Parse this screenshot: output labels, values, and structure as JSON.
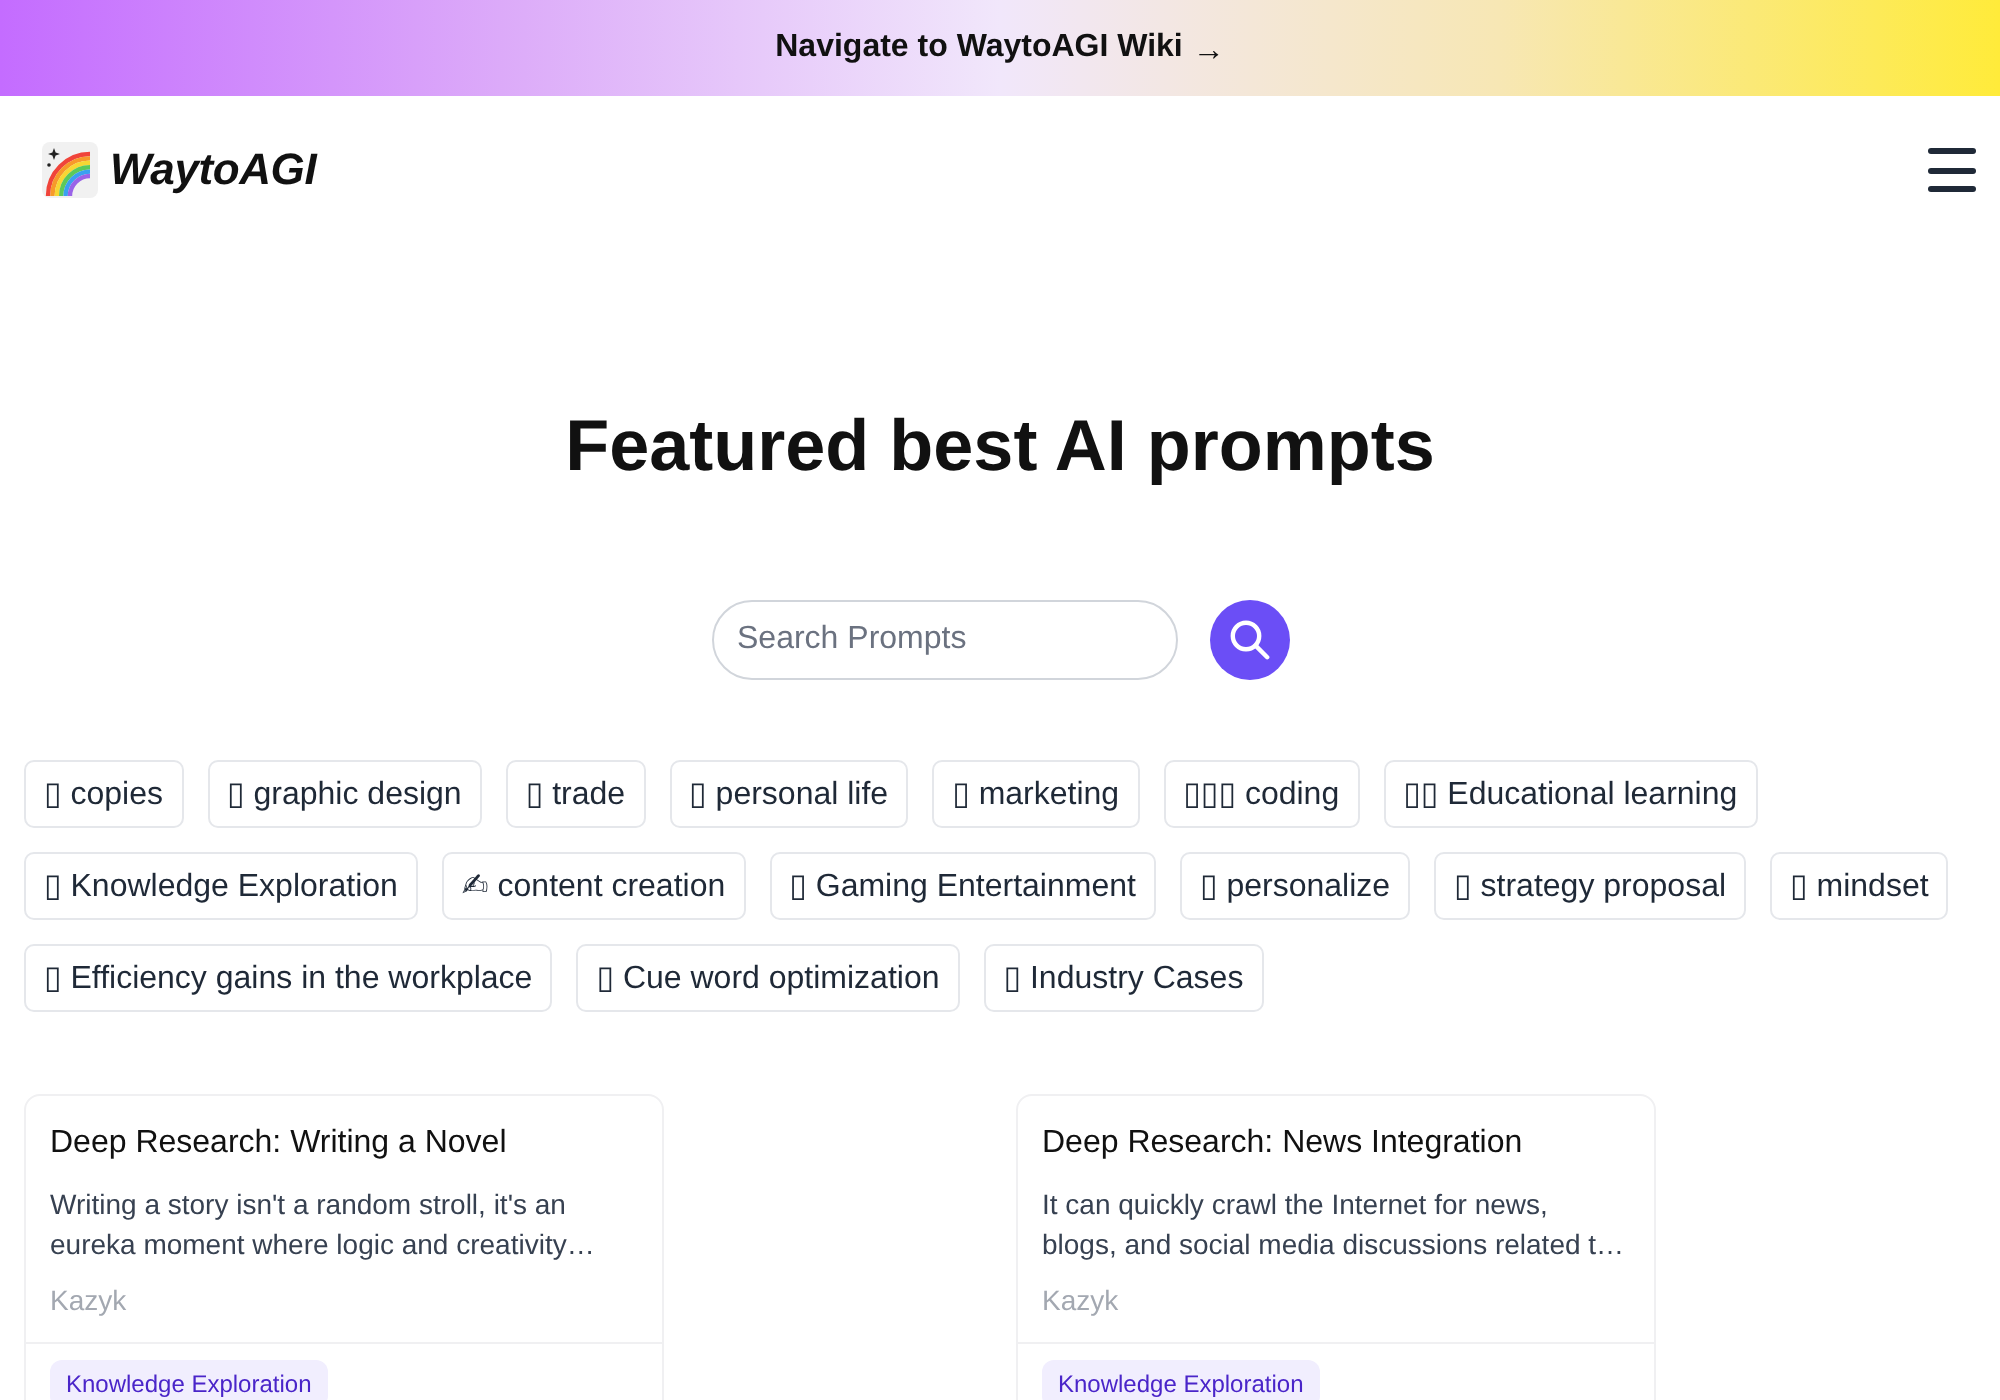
{
  "banner": {
    "link_text": "Navigate to WaytoAGI Wiki",
    "arrow": "→"
  },
  "header": {
    "logo_text": "WaytoAGI"
  },
  "hero": {
    "title": "Featured best AI prompts"
  },
  "search": {
    "placeholder": "Search Prompts"
  },
  "categories": [
    {
      "icon": "▯",
      "label": "copies"
    },
    {
      "icon": "▯",
      "label": "graphic design"
    },
    {
      "icon": "▯",
      "label": "trade"
    },
    {
      "icon": "▯",
      "label": "personal life"
    },
    {
      "icon": "▯",
      "label": "marketing"
    },
    {
      "icon": "▯▯▯",
      "label": "coding"
    },
    {
      "icon": "▯▯",
      "label": "Educational learning"
    },
    {
      "icon": "▯",
      "label": "Knowledge Exploration"
    },
    {
      "icon": "✍",
      "label": "content creation"
    },
    {
      "icon": "▯",
      "label": "Gaming Entertainment"
    },
    {
      "icon": "▯",
      "label": "personalize"
    },
    {
      "icon": "▯",
      "label": "strategy proposal"
    },
    {
      "icon": "▯",
      "label": "mindset"
    },
    {
      "icon": "▯",
      "label": "Efficiency gains in the workplace"
    },
    {
      "icon": "▯",
      "label": "Cue word optimization"
    },
    {
      "icon": "▯",
      "label": "Industry Cases"
    }
  ],
  "prompt_cards": [
    {
      "title": "Deep Research: Writing a Novel",
      "description": "Writing a story isn't a random stroll, it's an eureka moment where logic and creativity…",
      "author": "Kazyk",
      "tags": [
        "Knowledge Exploration"
      ]
    },
    {
      "title": "Deep Research: News Integration",
      "description": "It can quickly crawl the Internet for news, blogs, and social media discussions related t…",
      "author": "Kazyk",
      "tags": [
        "Knowledge Exploration"
      ]
    }
  ]
}
